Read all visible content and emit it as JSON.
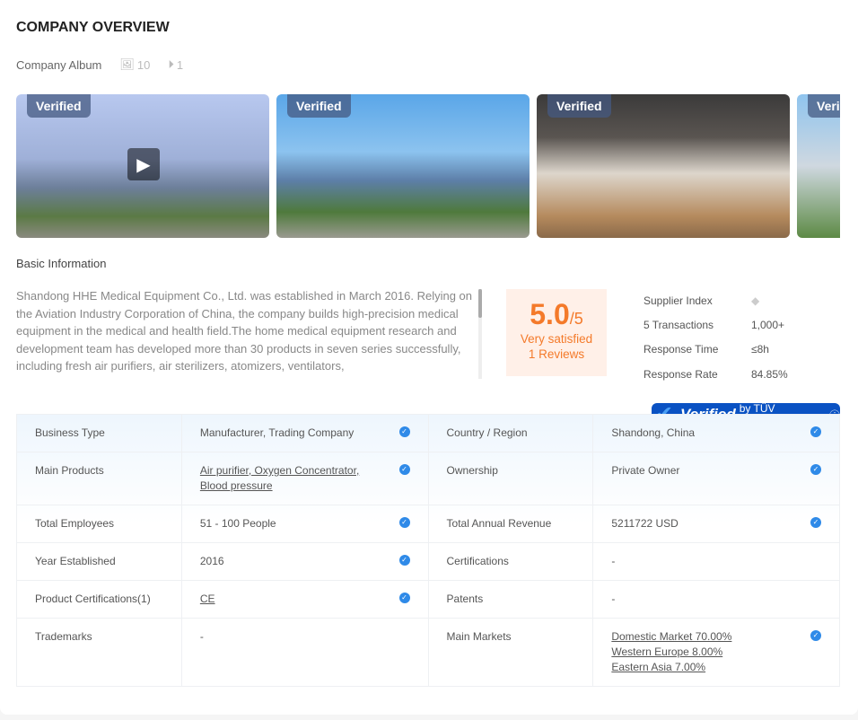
{
  "title": "COMPANY OVERVIEW",
  "album": {
    "label": "Company Album",
    "images": "10",
    "videos": "1",
    "verified": "Verified"
  },
  "basic_label": "Basic Information",
  "description": "Shandong HHE Medical Equipment Co., Ltd. was established in March 2016. Relying on the Aviation Industry Corporation of China, the company builds high-precision medical equipment in the medical and health field.The home medical equipment research and development team has developed more than 30 products in seven series successfully, including fresh air purifiers, air sterilizers, atomizers, ventilators,",
  "rating": {
    "score": "5.0",
    "max": "/5",
    "label": "Very satisfied",
    "reviews": "1 Reviews"
  },
  "stats": [
    {
      "k": "Supplier Index",
      "v": ""
    },
    {
      "k": "5 Transactions",
      "v": "1,000+"
    },
    {
      "k": "Response Time",
      "v": "≤8h"
    },
    {
      "k": "Response Rate",
      "v": "84.85%"
    }
  ],
  "tuv": {
    "verified": "Verified",
    "by": "by TÜV Rheinland"
  },
  "rows": [
    {
      "k1": "Business Type",
      "v1": [
        "Manufacturer, Trading Company"
      ],
      "c1": true,
      "k2": "Country / Region",
      "v2": [
        "Shandong, China"
      ],
      "c2": true
    },
    {
      "k1": "Main Products",
      "v1": [
        "Air purifier, Oxygen Concentrator,",
        "Blood pressure"
      ],
      "l1": true,
      "c1": true,
      "k2": "Ownership",
      "v2": [
        "Private Owner"
      ],
      "c2": true
    },
    {
      "k1": "Total Employees",
      "v1": [
        "51 - 100 People"
      ],
      "c1": true,
      "k2": "Total Annual Revenue",
      "v2": [
        "5211722 USD"
      ],
      "c2": true
    },
    {
      "k1": "Year Established",
      "v1": [
        "2016"
      ],
      "c1": true,
      "k2": "Certifications",
      "v2": [
        "-"
      ],
      "c2": false
    },
    {
      "k1": "Product Certifications(1)",
      "v1": [
        "CE"
      ],
      "l1": true,
      "c1": true,
      "k2": "Patents",
      "v2": [
        "-"
      ],
      "c2": false
    },
    {
      "k1": "Trademarks",
      "v1": [
        "-"
      ],
      "c1": false,
      "k2": "Main Markets",
      "v2": [
        "Domestic Market 70.00%",
        "Western Europe 8.00%",
        "Eastern Asia 7.00%"
      ],
      "l2": true,
      "c2": true
    }
  ]
}
